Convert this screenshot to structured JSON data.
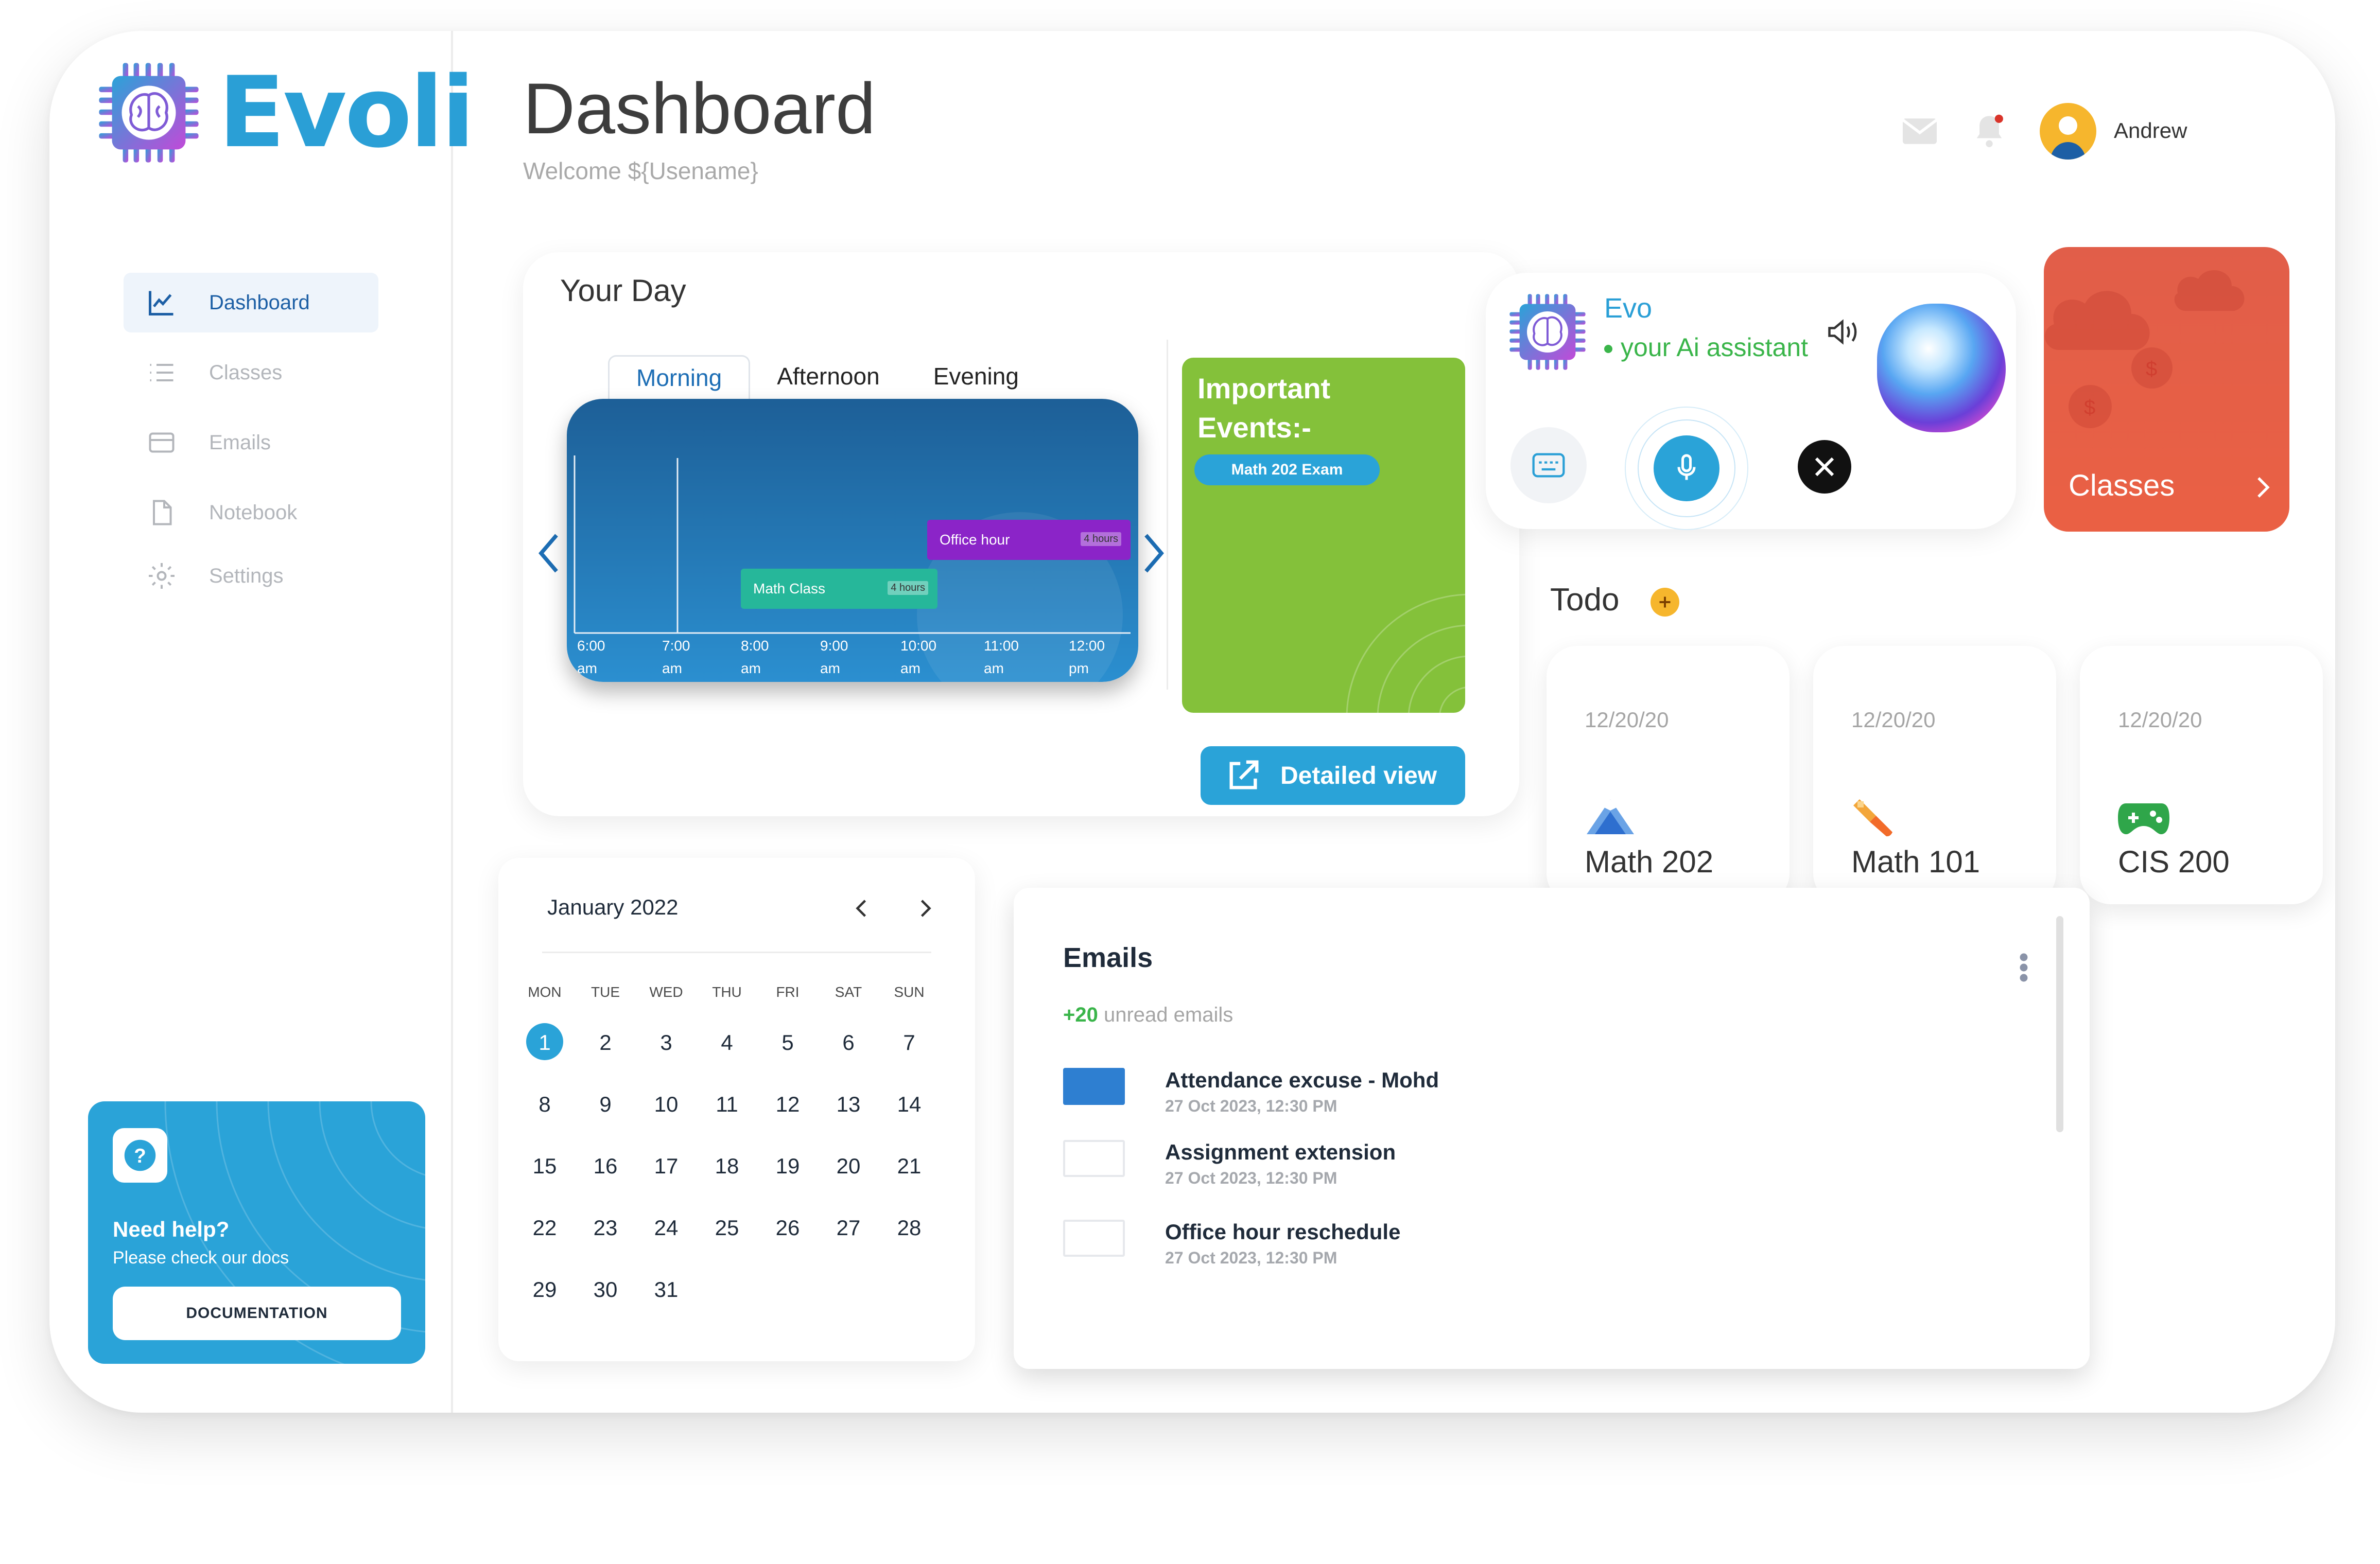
{
  "app": {
    "name": "Evoli"
  },
  "sidebar": {
    "items": [
      {
        "label": "Dashboard",
        "icon": "chart-line-icon",
        "active": true
      },
      {
        "label": "Classes",
        "icon": "list-icon"
      },
      {
        "label": "Emails",
        "icon": "card-icon"
      },
      {
        "label": "Notebook",
        "icon": "document-icon"
      },
      {
        "label": "Settings",
        "icon": "gear-icon"
      }
    ],
    "help": {
      "title": "Need help?",
      "subtitle": "Please check our docs",
      "button": "DOCUMENTATION",
      "icon": "question-icon"
    }
  },
  "header": {
    "title": "Dashboard",
    "subtitle": "Welcome ${Usename}",
    "user": "Andrew"
  },
  "your_day": {
    "title": "Your Day",
    "tabs": [
      "Morning",
      "Afternoon",
      "Evening"
    ],
    "active_tab": "Morning",
    "ticks": [
      {
        "time": "6:00",
        "ampm": "am"
      },
      {
        "time": "7:00",
        "ampm": "am"
      },
      {
        "time": "8:00",
        "ampm": "am"
      },
      {
        "time": "9:00",
        "ampm": "am"
      },
      {
        "time": "10:00",
        "ampm": "am"
      },
      {
        "time": "11:00",
        "ampm": "am"
      },
      {
        "time": "12:00",
        "ampm": "pm"
      }
    ],
    "events": [
      {
        "label": "Office hour",
        "duration": "4 hours",
        "color": "#8b24c8"
      },
      {
        "label": "Math Class",
        "duration": "4 hours",
        "color": "#26b79a"
      }
    ],
    "important": {
      "title": "Important Events:-",
      "item": "Math 202 Exam"
    },
    "detail_button": "Detailed view"
  },
  "evo": {
    "name": "Evo",
    "subtitle": "your Ai assistant"
  },
  "classes_card": {
    "label": "Classes"
  },
  "todo": {
    "title": "Todo",
    "items": [
      {
        "date": "12/20/20",
        "name": "Math 202",
        "icon": "mountain-icon"
      },
      {
        "date": "12/20/20",
        "name": "Math 101",
        "icon": "paintbrush-icon"
      },
      {
        "date": "12/20/20",
        "name": "CIS 200",
        "icon": "gamepad-icon"
      }
    ]
  },
  "calendar": {
    "month": "January 2022",
    "weekdays": [
      "MON",
      "TUE",
      "WED",
      "THU",
      "FRI",
      "SAT",
      "SUN"
    ],
    "days": [
      "1",
      "2",
      "3",
      "4",
      "5",
      "6",
      "7",
      "8",
      "9",
      "10",
      "11",
      "12",
      "13",
      "14",
      "15",
      "16",
      "17",
      "18",
      "19",
      "20",
      "21",
      "22",
      "23",
      "24",
      "25",
      "26",
      "27",
      "28",
      "29",
      "30",
      "31"
    ],
    "selected": "1"
  },
  "emails": {
    "title": "Emails",
    "count": "+20",
    "count_label": "unread emails",
    "items": [
      {
        "subject": "Attendance excuse - Mohd",
        "time": "27 Oct 2023, 12:30 PM",
        "checked": true
      },
      {
        "subject": "Assignment extension",
        "time": "27 Oct 2023, 12:30 PM",
        "checked": false
      },
      {
        "subject": "Office hour reschedule",
        "time": "27 Oct 2023, 12:30 PM",
        "checked": false
      }
    ]
  },
  "colors": {
    "brand": "#2a9fd6",
    "green": "#84c13a",
    "classes": "#e45f47",
    "purple": "#8b24c8",
    "teal": "#26b79a"
  }
}
